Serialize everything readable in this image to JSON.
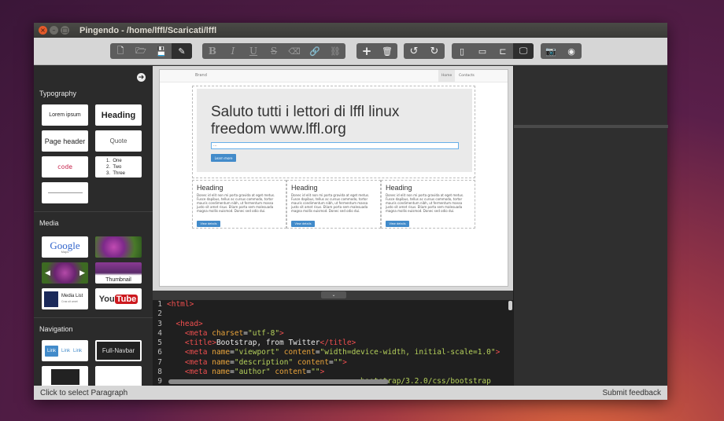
{
  "window": {
    "title": "Pingendo - /home/lffl/Scaricati/lffl",
    "close": "×",
    "minimize": "–",
    "maximize": "□"
  },
  "toolbar": {
    "file": [
      {
        "name": "new-file",
        "glyph": "🗋"
      },
      {
        "name": "open-folder",
        "glyph": "🗁"
      },
      {
        "name": "save",
        "glyph": "💾"
      },
      {
        "name": "edit-pencil",
        "glyph": "✎"
      }
    ],
    "format": [
      {
        "name": "bold",
        "glyph": "B"
      },
      {
        "name": "italic",
        "glyph": "I"
      },
      {
        "name": "underline",
        "glyph": "U"
      },
      {
        "name": "strikethrough",
        "glyph": "S"
      },
      {
        "name": "eraser",
        "glyph": "⌫"
      },
      {
        "name": "link",
        "glyph": "🔗"
      },
      {
        "name": "unlink",
        "glyph": "⛓"
      }
    ],
    "add": "+",
    "delete": "🗑",
    "undo": "↺",
    "redo": "↻",
    "devices": [
      {
        "name": "phone",
        "glyph": "▯"
      },
      {
        "name": "tablet",
        "glyph": "▭"
      },
      {
        "name": "laptop",
        "glyph": "⊏"
      },
      {
        "name": "desktop",
        "glyph": "🖵"
      }
    ],
    "camera": "📷",
    "globe": "◉"
  },
  "sidebar": {
    "back": "➜",
    "sections": [
      {
        "title": "Typography",
        "tiles": [
          "Lorem ipsum",
          "Heading",
          "Page header",
          "Quote",
          "code",
          "1. One 2. Two 3. Three",
          "——————"
        ]
      },
      {
        "title": "Media",
        "tiles": [
          "Google Maps",
          "",
          "",
          "Thumbnail",
          "Media List",
          "YouTube"
        ]
      },
      {
        "title": "Navigation",
        "tiles": [
          "Link Link Link",
          "Full-Navbar",
          "",
          ""
        ]
      }
    ],
    "typography": {
      "lorem": "Lorem ipsum",
      "heading": "Heading",
      "page_header": "Page header",
      "quote": "Quote",
      "code": "code",
      "list": [
        "One",
        "Two",
        "Three"
      ]
    },
    "media": {
      "google": "Google",
      "maps": "Maps",
      "thumbnail": "Thumbnail",
      "media_list": "Media List",
      "media_list_sub": "Cras sit amet",
      "youtube_you": "You",
      "youtube_tube": "Tube"
    },
    "navigation": {
      "link": "Link",
      "full_navbar": "Full-Navbar"
    }
  },
  "preview": {
    "brand": "Brand",
    "nav": [
      "Home",
      "Contacts"
    ],
    "jumbotron_title": "Saluto tutti i lettori di lffl linux freedom www.lffl.org",
    "input_value": "...",
    "learn_more": "Learn more",
    "columns": [
      {
        "heading": "Heading",
        "text": "Donec id elit non mi porta gravida at eget metus. Fusce dapibus, tellus ac cursus commodo, tortor mauris condimentum nibh, ut fermentum massa justo sit amet risus. Etiam porta sem malesuada magna mollis euismod. Donec sed odio dui.",
        "button": "View details"
      },
      {
        "heading": "Heading",
        "text": "Donec id elit non mi porta gravida at eget metus. Fusce dapibus, tellus ac cursus commodo, tortor mauris condimentum nibh, ut fermentum massa justo sit amet risus. Etiam porta sem malesuada magna mollis euismod. Donec sed odio dui.",
        "button": "View details"
      },
      {
        "heading": "Heading",
        "text": "Donec id elit non mi porta gravida at eget metus. Fusce dapibus, tellus ac cursus commodo, tortor mauris condimentum nibh, ut fermentum massa justo sit amet risus. Etiam porta sem malesuada magna mollis euismod. Donec sed odio dui.",
        "button": "View details"
      }
    ]
  },
  "code": {
    "lines": [
      {
        "n": "1",
        "parts": [
          [
            "tag",
            "<html>"
          ]
        ]
      },
      {
        "n": "2",
        "parts": []
      },
      {
        "n": "3",
        "parts": [
          [
            "txt",
            "  "
          ],
          [
            "tag",
            "<head>"
          ]
        ]
      },
      {
        "n": "4",
        "parts": [
          [
            "txt",
            "    "
          ],
          [
            "tag",
            "<meta "
          ],
          [
            "attr",
            "charset"
          ],
          [
            "txt",
            "="
          ],
          [
            "val",
            "\"utf-8\""
          ],
          [
            "tag",
            ">"
          ]
        ]
      },
      {
        "n": "5",
        "parts": [
          [
            "txt",
            "    "
          ],
          [
            "tag",
            "<title>"
          ],
          [
            "txt",
            "Bootstrap, from Twitter"
          ],
          [
            "tag",
            "</title>"
          ]
        ]
      },
      {
        "n": "6",
        "parts": [
          [
            "txt",
            "    "
          ],
          [
            "tag",
            "<meta "
          ],
          [
            "attr",
            "name"
          ],
          [
            "txt",
            "="
          ],
          [
            "val",
            "\"viewport\""
          ],
          [
            "attr",
            " content"
          ],
          [
            "txt",
            "="
          ],
          [
            "val",
            "\"width=device-width, initial-scale=1.0\""
          ],
          [
            "tag",
            ">"
          ]
        ]
      },
      {
        "n": "7",
        "parts": [
          [
            "txt",
            "    "
          ],
          [
            "tag",
            "<meta "
          ],
          [
            "attr",
            "name"
          ],
          [
            "txt",
            "="
          ],
          [
            "val",
            "\"description\""
          ],
          [
            "attr",
            " content"
          ],
          [
            "txt",
            "="
          ],
          [
            "val",
            "\"\""
          ],
          [
            "tag",
            ">"
          ]
        ]
      },
      {
        "n": "8",
        "parts": [
          [
            "txt",
            "    "
          ],
          [
            "tag",
            "<meta "
          ],
          [
            "attr",
            "name"
          ],
          [
            "txt",
            "="
          ],
          [
            "val",
            "\"author\""
          ],
          [
            "attr",
            " content"
          ],
          [
            "txt",
            "="
          ],
          [
            "val",
            "\"\""
          ],
          [
            "tag",
            ">"
          ]
        ]
      },
      {
        "n": "9",
        "parts": [
          [
            "txt",
            "                                           "
          ],
          [
            "val",
            "bootstrap/3.2.0/css/bootstrap"
          ]
        ]
      }
    ],
    "grip": "⌄"
  },
  "status": {
    "left": "Click to select Paragraph",
    "right": "Submit feedback"
  }
}
